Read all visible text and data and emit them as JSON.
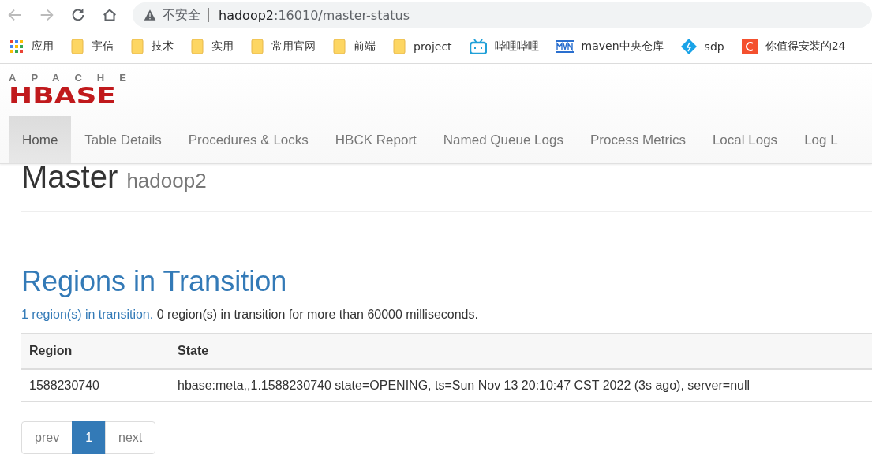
{
  "browser": {
    "warning": "不安全",
    "host": "hadoop2",
    "path": ":16010/master-status"
  },
  "bookmarks": [
    {
      "label": "应用",
      "kind": "apps"
    },
    {
      "label": "宇信",
      "kind": "folder"
    },
    {
      "label": "技术",
      "kind": "folder"
    },
    {
      "label": "实用",
      "kind": "folder"
    },
    {
      "label": "常用官网",
      "kind": "folder"
    },
    {
      "label": "前端",
      "kind": "folder"
    },
    {
      "label": "project",
      "kind": "folder"
    },
    {
      "label": "哔哩哔哩",
      "kind": "tv"
    },
    {
      "label": "maven中央仓库",
      "kind": "maven"
    },
    {
      "label": "sdp",
      "kind": "diamond"
    },
    {
      "label": "你值得安装的24",
      "kind": "letter"
    }
  ],
  "logo": {
    "top": "APACHE",
    "main": "HBASE"
  },
  "nav": [
    {
      "label": "Home",
      "selected": true
    },
    {
      "label": "Table Details",
      "selected": false
    },
    {
      "label": "Procedures & Locks",
      "selected": false
    },
    {
      "label": "HBCK Report",
      "selected": false
    },
    {
      "label": "Named Queue Logs",
      "selected": false
    },
    {
      "label": "Process Metrics",
      "selected": false
    },
    {
      "label": "Local Logs",
      "selected": false
    },
    {
      "label": "Log L",
      "selected": false
    }
  ],
  "heading": {
    "title": "Master",
    "host": "hadoop2"
  },
  "rit": {
    "title": "Regions in Transition",
    "link": "1 region(s) in transition.",
    "note": " 0 region(s) in transition for more than 60000 milliseconds.",
    "columns": [
      "Region",
      "State"
    ],
    "rows": [
      [
        "1588230740",
        "hbase:meta,,1.1588230740 state=OPENING, ts=Sun Nov 13 20:10:47 CST 2022 (3s ago), server=null"
      ]
    ]
  },
  "pagination": [
    {
      "label": "prev",
      "selected": false
    },
    {
      "label": "1",
      "selected": true
    },
    {
      "label": "next",
      "selected": false
    }
  ]
}
